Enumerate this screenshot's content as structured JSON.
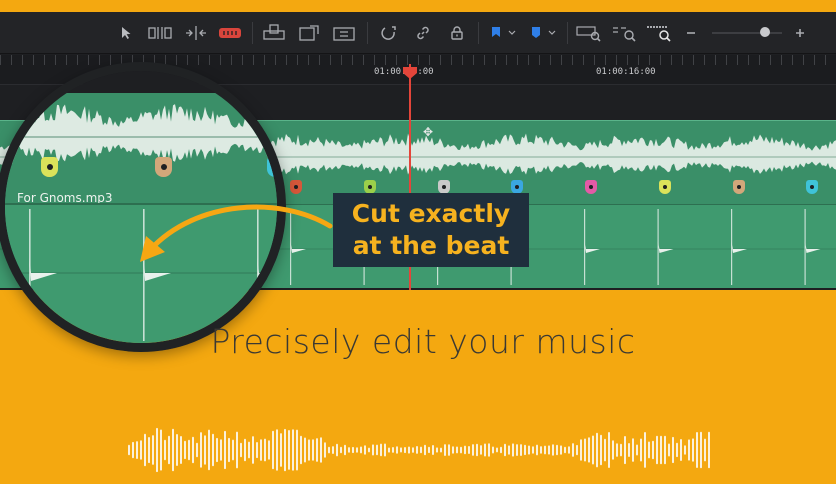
{
  "timeline": {
    "timecodes": [
      "01:00:14:00",
      "01:00:16:00"
    ],
    "clip_name": "For Gnoms.mp3",
    "colors": {
      "clip_green": "#3a8f68",
      "playhead": "#e4453a",
      "panel": "#1e1f22"
    }
  },
  "toolbar": {
    "icons": [
      "selection-arrow-icon",
      "trim-edit-icon",
      "dynamic-trim-icon",
      "blade-icon",
      "insert-clip-icon",
      "overwrite-clip-icon",
      "replace-clip-icon",
      "snapping-icon",
      "link-icon",
      "lock-icon",
      "flag-icon",
      "marker-icon",
      "zoom-full-icon",
      "zoom-detail-icon",
      "zoom-custom-icon",
      "zoom-out-icon",
      "zoom-in-icon"
    ]
  },
  "callout": {
    "line1": "Cut exactly",
    "line2": "at the beat",
    "bg_color": "#1f2f3d",
    "text_color": "#f6b21f"
  },
  "tagline": "Precisely edit your music",
  "background_color": "#f4a810"
}
